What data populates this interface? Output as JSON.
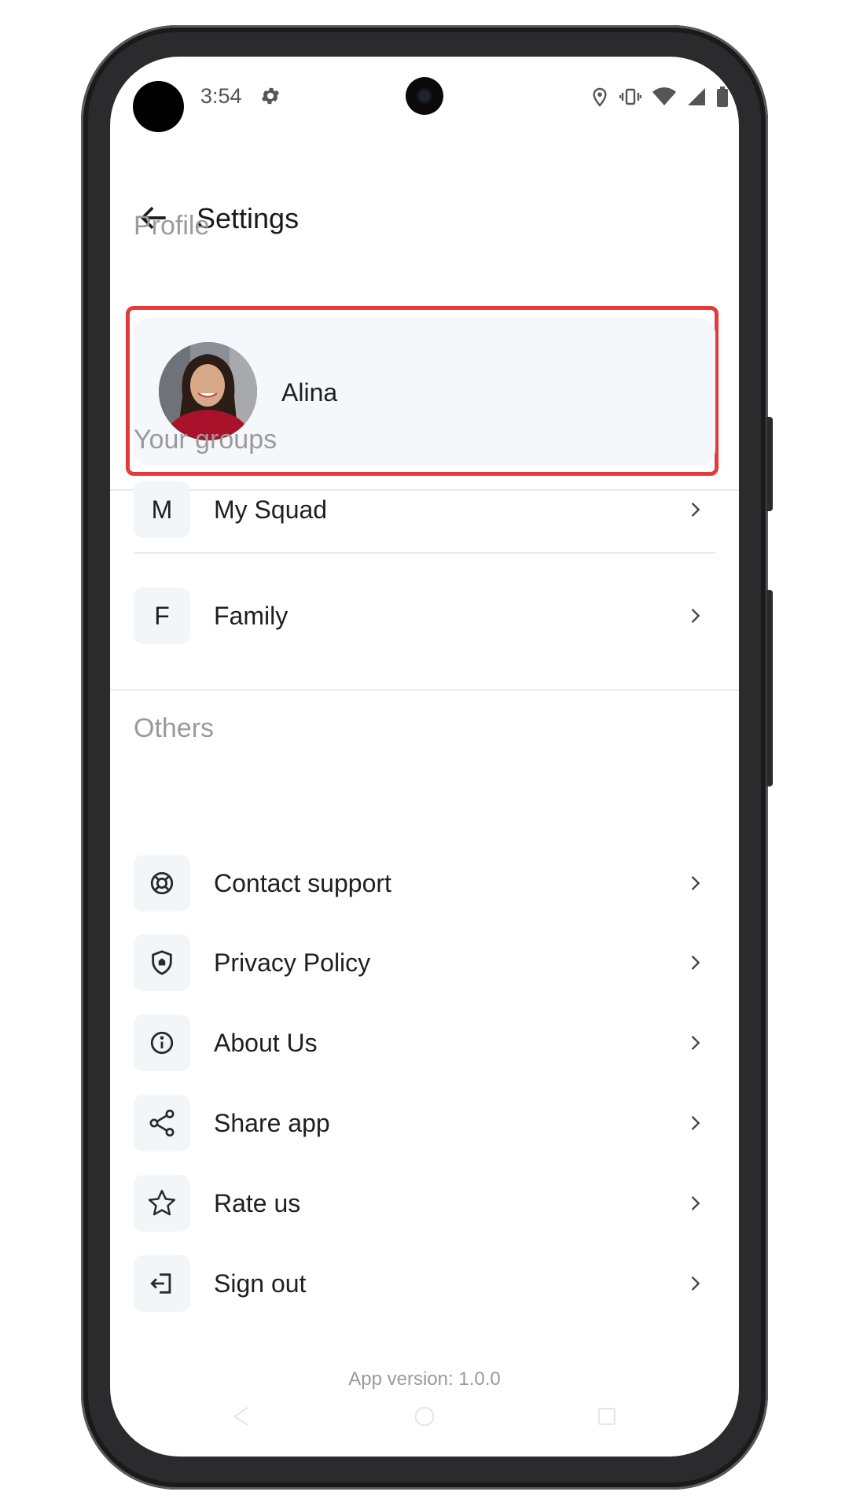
{
  "status_bar": {
    "time": "3:54"
  },
  "app_bar": {
    "title": "Settings"
  },
  "profile": {
    "section_label": "Profile",
    "name": "Alina"
  },
  "groups": {
    "section_label": "Your groups",
    "items": [
      {
        "initial": "M",
        "label": "My Squad"
      },
      {
        "initial": "F",
        "label": "Family"
      }
    ]
  },
  "others": {
    "section_label": "Others",
    "items": [
      {
        "icon": "lifebuoy-icon",
        "label": "Contact support"
      },
      {
        "icon": "shield-icon",
        "label": "Privacy Policy"
      },
      {
        "icon": "info-icon",
        "label": "About Us"
      },
      {
        "icon": "share-icon",
        "label": "Share app"
      },
      {
        "icon": "star-icon",
        "label": "Rate us"
      },
      {
        "icon": "sign-out-icon",
        "label": "Sign out"
      }
    ]
  },
  "footer": {
    "version": "App version: 1.0.0"
  },
  "colors": {
    "highlight_outline": "#e63a3a",
    "card_bg": "#f5f8fb",
    "section_head": "#9a9a9a"
  }
}
